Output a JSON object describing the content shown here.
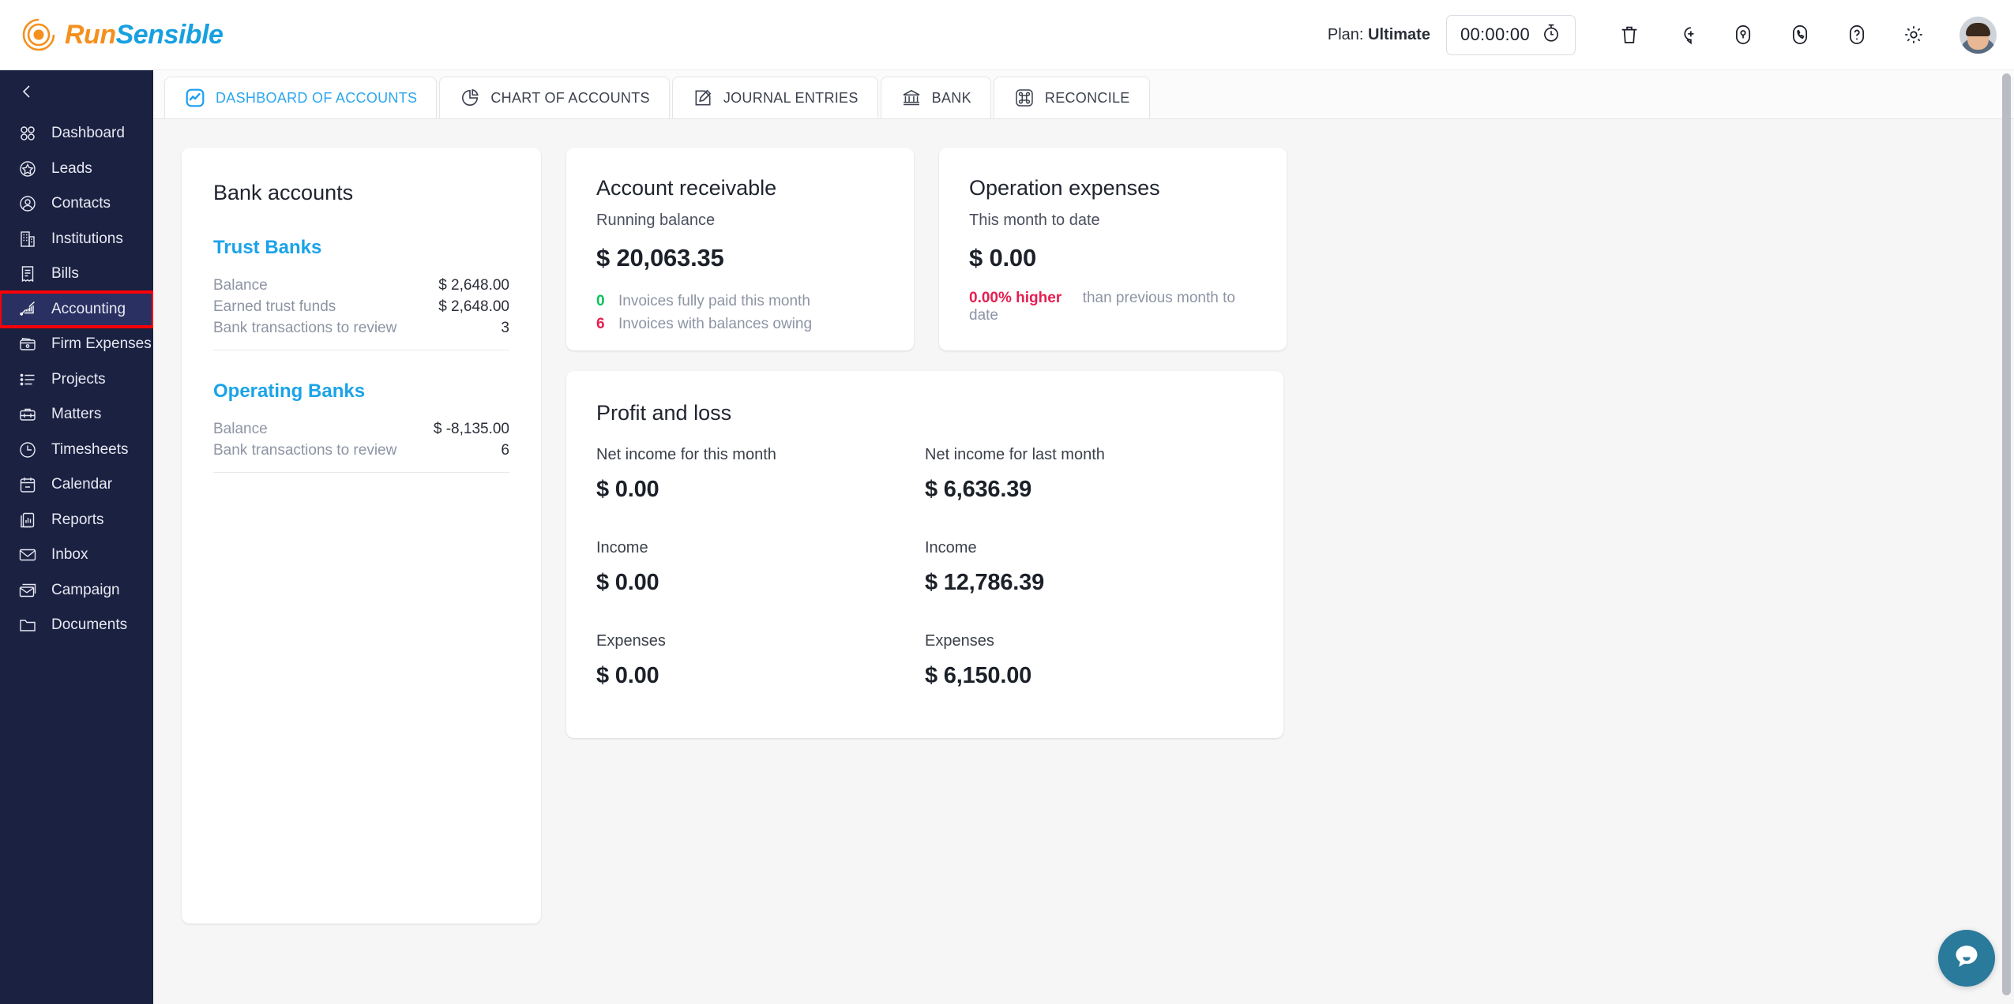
{
  "brand": {
    "run": "Run",
    "sensible": "Sensible",
    "logo_icon": "spiral-logo-icon",
    "orange": "#f5901e",
    "blue": "#18a0e0"
  },
  "topbar": {
    "plan_prefix": "Plan: ",
    "plan_value": "Ultimate",
    "timer_value": "00:00:00",
    "icons": [
      {
        "name": "stopwatch-icon",
        "label": "Timer"
      },
      {
        "name": "trash-icon",
        "label": "Trash"
      },
      {
        "name": "add-circle-icon",
        "label": "Add"
      },
      {
        "name": "notification-icon",
        "label": "Notifications"
      },
      {
        "name": "phone-icon",
        "label": "Calls"
      },
      {
        "name": "help-icon",
        "label": "Help"
      },
      {
        "name": "gear-icon",
        "label": "Settings"
      },
      {
        "name": "avatar",
        "label": "Profile"
      }
    ]
  },
  "sidebar": {
    "collapse_icon": "chevron-left-icon",
    "active": "Accounting",
    "items": [
      {
        "label": "Dashboard",
        "icon": "grid-icon"
      },
      {
        "label": "Leads",
        "icon": "star-circle-icon"
      },
      {
        "label": "Contacts",
        "icon": "user-circle-icon"
      },
      {
        "label": "Institutions",
        "icon": "building-icon"
      },
      {
        "label": "Bills",
        "icon": "receipt-icon"
      },
      {
        "label": "Accounting",
        "icon": "chart-pen-icon"
      },
      {
        "label": "Firm Expenses",
        "icon": "wallet-icon"
      },
      {
        "label": "Projects",
        "icon": "list-icon"
      },
      {
        "label": "Matters",
        "icon": "briefcase-icon"
      },
      {
        "label": "Timesheets",
        "icon": "clock-icon"
      },
      {
        "label": "Calendar",
        "icon": "calendar-icon"
      },
      {
        "label": "Reports",
        "icon": "report-icon"
      },
      {
        "label": "Inbox",
        "icon": "envelope-icon"
      },
      {
        "label": "Campaign",
        "icon": "campaign-icon"
      },
      {
        "label": "Documents",
        "icon": "folder-icon"
      }
    ]
  },
  "tabs": [
    {
      "label": "DASHBOARD OF ACCOUNTS",
      "icon": "activity-square-icon",
      "active": true
    },
    {
      "label": "CHART OF ACCOUNTS",
      "icon": "pie-chart-icon",
      "active": false
    },
    {
      "label": "JOURNAL ENTRIES",
      "icon": "pencil-note-icon",
      "active": false
    },
    {
      "label": "BANK",
      "icon": "bank-icon",
      "active": false
    },
    {
      "label": "RECONCILE",
      "icon": "command-square-icon",
      "active": false
    }
  ],
  "bank_accounts": {
    "title": "Bank accounts",
    "groups": [
      {
        "name": "Trust Banks",
        "rows": [
          {
            "label": "Balance",
            "value": "$ 2,648.00"
          },
          {
            "label": "Earned trust funds",
            "value": "$ 2,648.00"
          },
          {
            "label": "Bank transactions to review",
            "value": "3"
          }
        ]
      },
      {
        "name": "Operating Banks",
        "rows": [
          {
            "label": "Balance",
            "value": "$ -8,135.00"
          },
          {
            "label": "Bank transactions to review",
            "value": "6"
          }
        ]
      }
    ]
  },
  "account_receivable": {
    "title": "Account receivable",
    "subtitle": "Running balance",
    "amount": "$ 20,063.35",
    "lines": [
      {
        "num": "0",
        "text": "Invoices fully paid this month",
        "color": "#09c25a"
      },
      {
        "num": "6",
        "text": "Invoices with balances owing",
        "color": "#e61e50"
      }
    ]
  },
  "operation_expenses": {
    "title": "Operation expenses",
    "subtitle": "This month to date",
    "amount": "$ 0.00",
    "delta": "0.00% higher",
    "delta_color": "#e61e50",
    "delta_suffix": "than previous month to date"
  },
  "profit_and_loss": {
    "title": "Profit and loss",
    "cells": [
      {
        "label": "Net income for this month",
        "value": "$ 0.00"
      },
      {
        "label": "Net income for last month",
        "value": "$ 6,636.39"
      },
      {
        "label": "Income",
        "value": "$ 0.00"
      },
      {
        "label": "Income",
        "value": "$ 12,786.39"
      },
      {
        "label": "Expenses",
        "value": "$ 0.00"
      },
      {
        "label": "Expenses",
        "value": "$ 6,150.00"
      }
    ]
  },
  "chat": {
    "icon": "chat-bubble-icon",
    "color": "#2a7a9b"
  }
}
